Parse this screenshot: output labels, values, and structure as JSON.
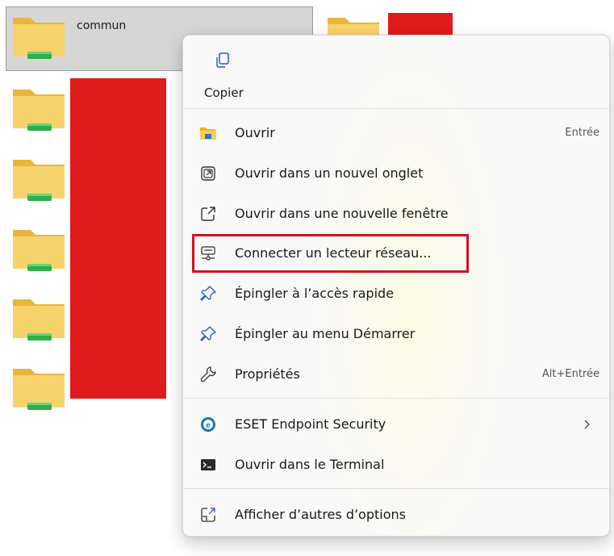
{
  "explorer": {
    "selected_folder_name": "commun",
    "colors": {
      "redaction": "#e01b1b",
      "selection_bg": "#d6d6d6",
      "highlight": "#d6111f"
    }
  },
  "context_menu": {
    "top_actions": [
      {
        "label": "Copier",
        "icon": "copy-icon"
      }
    ],
    "items": [
      {
        "label": "Ouvrir",
        "shortcut": "Entrée",
        "icon": "folder-open-icon"
      },
      {
        "label": "Ouvrir dans un nouvel onglet",
        "icon": "new-tab-icon"
      },
      {
        "label": "Ouvrir dans une nouvelle fenêtre",
        "icon": "new-window-icon"
      },
      {
        "label": "Connecter un lecteur réseau...",
        "icon": "network-drive-icon",
        "highlighted": true
      },
      {
        "label": "Épingler à l’accès rapide",
        "icon": "pin-icon"
      },
      {
        "label": "Épingler au menu Démarrer",
        "icon": "pin-icon"
      },
      {
        "label": "Propriétés",
        "shortcut": "Alt+Entrée",
        "icon": "wrench-icon"
      },
      {
        "label": "ESET Endpoint Security",
        "icon": "eset-icon",
        "submenu": true
      },
      {
        "label": "Ouvrir dans le Terminal",
        "icon": "terminal-icon"
      },
      {
        "label": "Afficher d’autres d’options",
        "icon": "more-options-icon"
      }
    ]
  }
}
